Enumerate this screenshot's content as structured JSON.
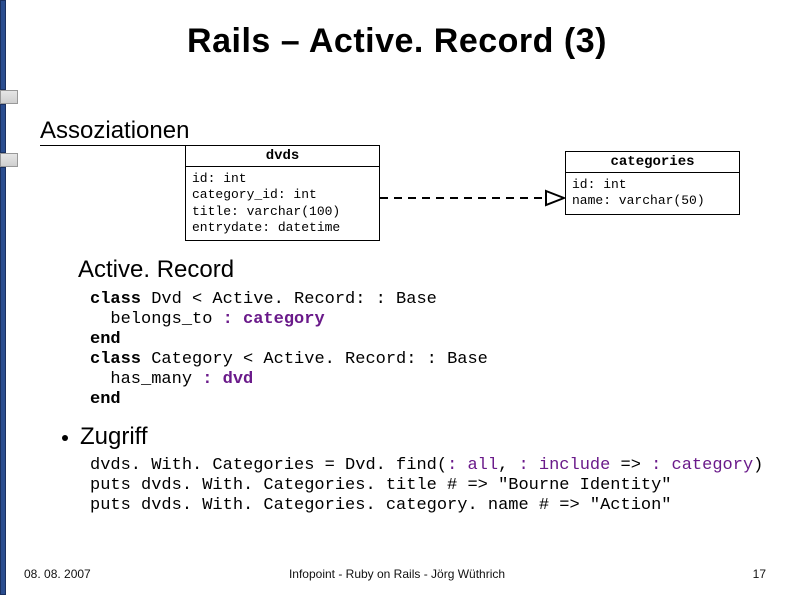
{
  "title": "Rails – Active. Record (3)",
  "sections": {
    "assoc": "Assoziationen",
    "ar": "Active. Record",
    "zugriff": "Zugriff"
  },
  "diagram": {
    "dvds": {
      "name": "dvds",
      "cols": "id: int\ncategory_id: int\ntitle: varchar(100)\nentrydate: datetime"
    },
    "categories": {
      "name": "categories",
      "cols": "id: int\nname: varchar(50)"
    }
  },
  "code1": {
    "l1a": "class",
    "l1b": " Dvd < Active. Record: : Base",
    "l2a": "  belongs_to ",
    "l2b": ": category",
    "l3": "end",
    "l4a": "class",
    "l4b": " Category < Active. Record: : Base",
    "l5a": "  has_many ",
    "l5b": ": dvd",
    "l6": "end"
  },
  "code2": {
    "l1a": "dvds. With. Categories = Dvd. find(",
    "l1b": ": all",
    "l1c": ", ",
    "l1d": ": include",
    "l1e": " => ",
    "l1f": ": category",
    "l1g": ")",
    "l2": "puts dvds. With. Categories. title # => \"Bourne Identity\"",
    "l3": "puts dvds. With. Categories. category. name # => \"Action\""
  },
  "footer": {
    "date": "08. 08. 2007",
    "center": "Infopoint - Ruby on Rails - Jörg Wüthrich",
    "num": "17"
  }
}
